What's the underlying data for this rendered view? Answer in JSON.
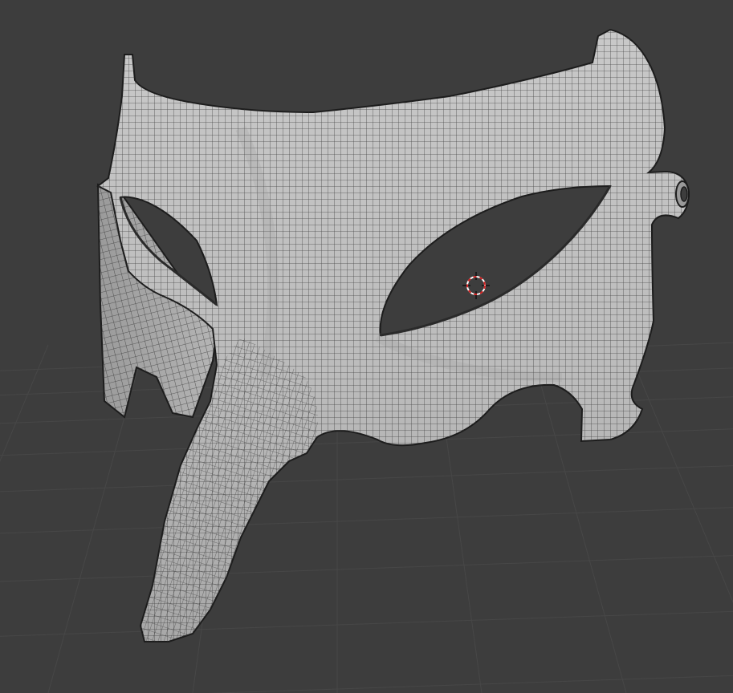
{
  "viewport": {
    "background_color": "#3d3d3d",
    "grid_color": "#464646",
    "mesh_fill_color": "#b9b9b9",
    "mesh_shadow_color": "#8e8e8e",
    "wire_color": "#2a2a2a",
    "outline_color": "#1c1c1c",
    "cursor_ring_colors": [
      "#d02020",
      "#ffffff"
    ],
    "cursor_icon": "3d-cursor-icon",
    "object": "mask-mesh",
    "view": "perspective"
  }
}
